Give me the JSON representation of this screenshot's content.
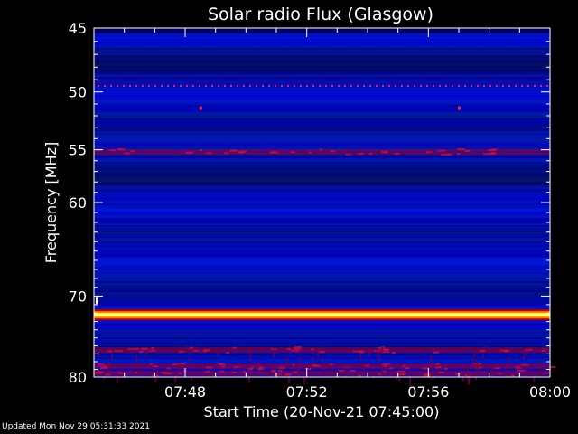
{
  "chart_data": {
    "type": "heatmap",
    "title": "Solar radio Flux (Glasgow)",
    "xlabel": "Start Time (20-Nov-21 07:45:00)",
    "ylabel": "Frequency [MHz]",
    "x_ticks": [
      "07:48",
      "07:52",
      "07:56",
      "08:00"
    ],
    "x_tick_minutes": [
      3,
      7,
      11,
      15
    ],
    "xlim_minutes": [
      0,
      15
    ],
    "y_ticks": [
      "45",
      "50",
      "55",
      "60",
      "70",
      "80"
    ],
    "y_tick_values": [
      45,
      50,
      55,
      60,
      70,
      80
    ],
    "ylim": [
      45,
      80
    ],
    "y_scale": "log",
    "features": {
      "strong_band_mhz": 72.2,
      "dotted_line_mhz": 49.5,
      "moderate_band_mhz": [
        55.2,
        76.5,
        78.6,
        79.5
      ]
    },
    "colors": {
      "background": "#000000",
      "low": "#0000c8",
      "mid": "#800040",
      "high": "#ffff60"
    }
  },
  "footer": "Updated Mon Nov 29 05:31:33 2021"
}
